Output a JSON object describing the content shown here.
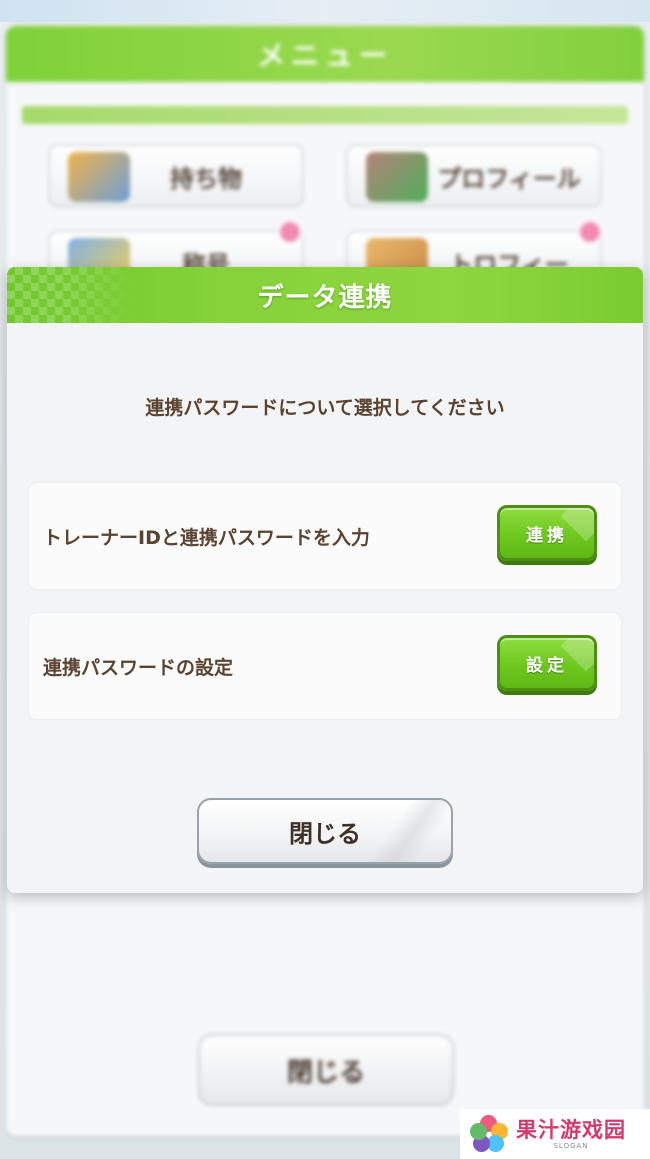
{
  "background_menu": {
    "title": "メニュー",
    "buttons": [
      {
        "label": "持ち物"
      },
      {
        "label": "プロフィール"
      },
      {
        "label": "称号"
      },
      {
        "label": "トロフィー"
      }
    ],
    "close_label": "閉じる"
  },
  "dialog": {
    "title": "データ連携",
    "prompt": "連携パスワードについて選択してください",
    "options": [
      {
        "label": "トレーナーIDと連携パスワードを入力",
        "button": "連携"
      },
      {
        "label": "連携パスワードの設定",
        "button": "設定"
      }
    ],
    "close_label": "閉じる"
  },
  "watermark": {
    "name": "果汁游戏园",
    "slogan": "SLOGAN"
  },
  "colors": {
    "header_green": "#86d23a",
    "button_green": "#6ec81e",
    "text_brown": "#5a4330",
    "badge_pink": "#f28ab0",
    "watermark_pink": "#d23a6f"
  }
}
